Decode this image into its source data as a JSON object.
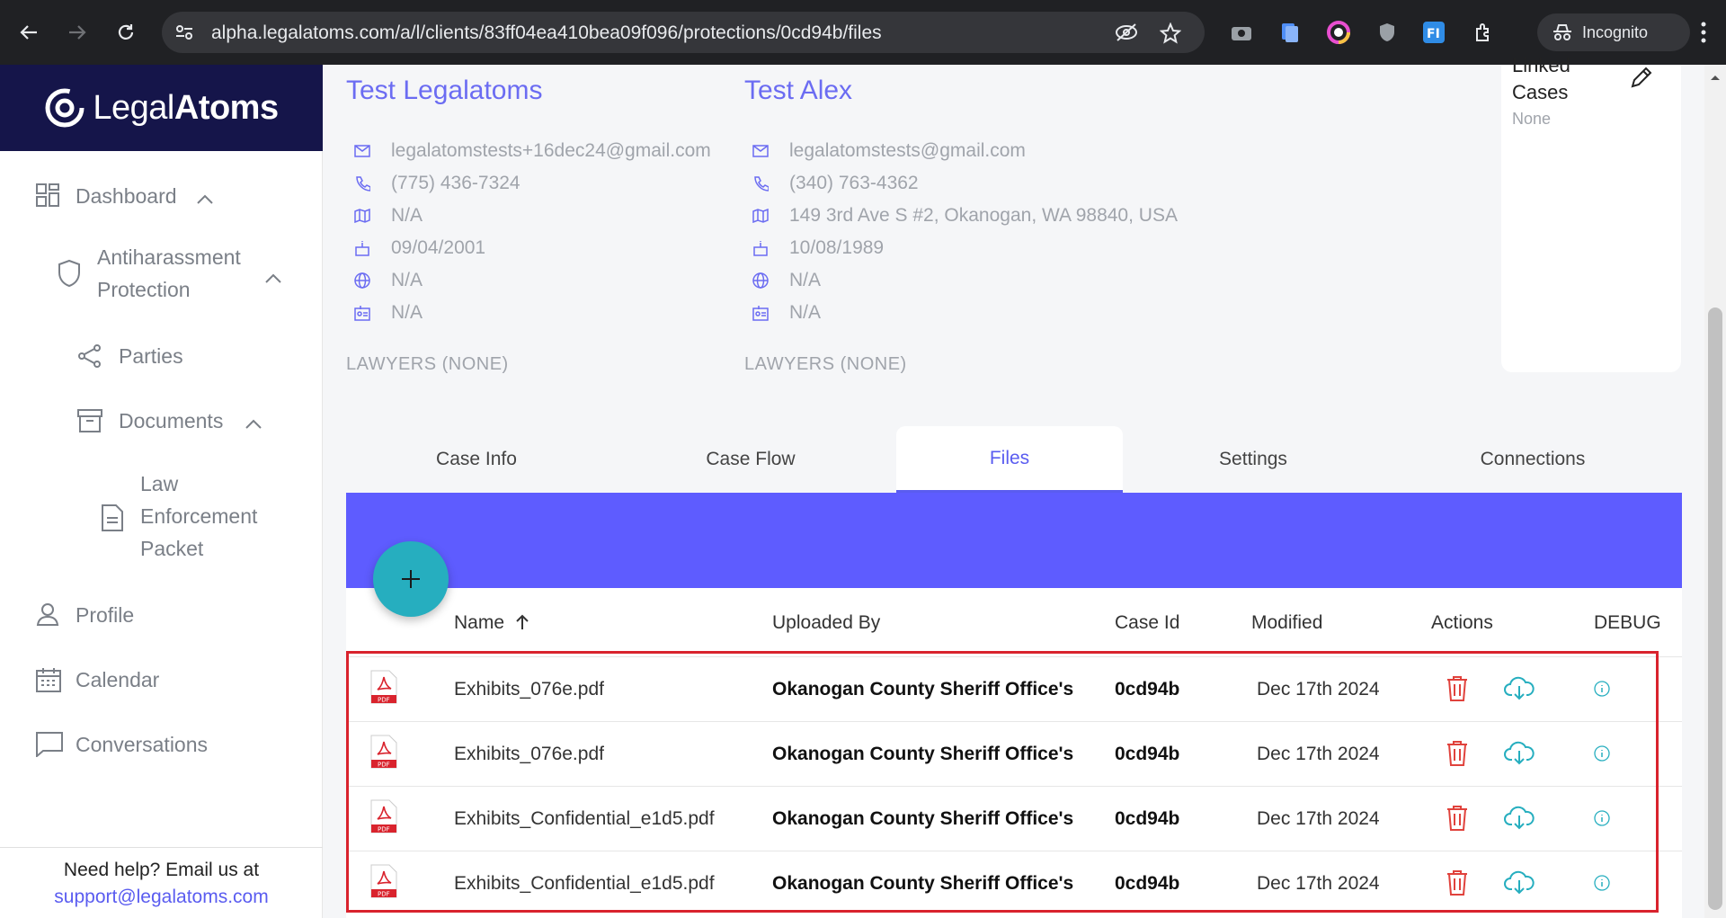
{
  "browser": {
    "url": "alpha.legalatoms.com/a/l/clients/83ff04ea410bea09f096/protections/0cd94b/files",
    "incognito_label": "Incognito"
  },
  "brand": {
    "name_light": "Legal",
    "name_bold": "Atoms"
  },
  "sidebar": {
    "dashboard": "Dashboard",
    "protection_line1": "Antiharassment",
    "protection_line2": "Protection",
    "parties": "Parties",
    "documents": "Documents",
    "packet_line1": "Law",
    "packet_line2": "Enforcement",
    "packet_line3": "Packet",
    "profile": "Profile",
    "calendar": "Calendar",
    "conversations": "Conversations",
    "help_text": "Need help? Email us at",
    "help_email": "support@legalatoms.com"
  },
  "party1": {
    "name": "Test Legalatoms",
    "email": "legalatomstests+16dec24@gmail.com",
    "phone": "(775) 436-7324",
    "address": "N/A",
    "dob": "09/04/2001",
    "language": "N/A",
    "id": "N/A",
    "lawyers": "LAWYERS (NONE)"
  },
  "party2": {
    "name": "Test Alex",
    "email": "legalatomstests@gmail.com",
    "phone": "(340) 763-4362",
    "address": "149 3rd Ave S #2, Okanogan, WA 98840, USA",
    "dob": "10/08/1989",
    "language": "N/A",
    "id": "N/A",
    "lawyers": "LAWYERS (NONE)"
  },
  "linked_cases": {
    "title_line1": "Linked",
    "title_line2": "Cases",
    "value": "None"
  },
  "tabs": [
    "Case Info",
    "Case Flow",
    "Files",
    "Settings",
    "Connections"
  ],
  "table": {
    "headers": {
      "name": "Name",
      "uploaded_by": "Uploaded By",
      "case_id": "Case Id",
      "modified": "Modified",
      "actions": "Actions",
      "debug": "DEBUG"
    },
    "rows": [
      {
        "name": "Exhibits_076e.pdf",
        "uploaded_by": "Okanogan County Sheriff Office's",
        "case_id": "0cd94b",
        "modified": "Dec 17th 2024"
      },
      {
        "name": "Exhibits_076e.pdf",
        "uploaded_by": "Okanogan County Sheriff Office's",
        "case_id": "0cd94b",
        "modified": "Dec 17th 2024"
      },
      {
        "name": "Exhibits_Confidential_e1d5.pdf",
        "uploaded_by": "Okanogan County Sheriff Office's",
        "case_id": "0cd94b",
        "modified": "Dec 17th 2024"
      },
      {
        "name": "Exhibits_Confidential_e1d5.pdf",
        "uploaded_by": "Okanogan County Sheriff Office's",
        "case_id": "0cd94b",
        "modified": "Dec 17th 2024"
      }
    ]
  },
  "colors": {
    "accent": "#5e5cff",
    "brand_bg": "#15154a",
    "fab": "#26aebf",
    "delete": "#e0423c",
    "download": "#26aebf",
    "highlight": "#d9232d"
  }
}
